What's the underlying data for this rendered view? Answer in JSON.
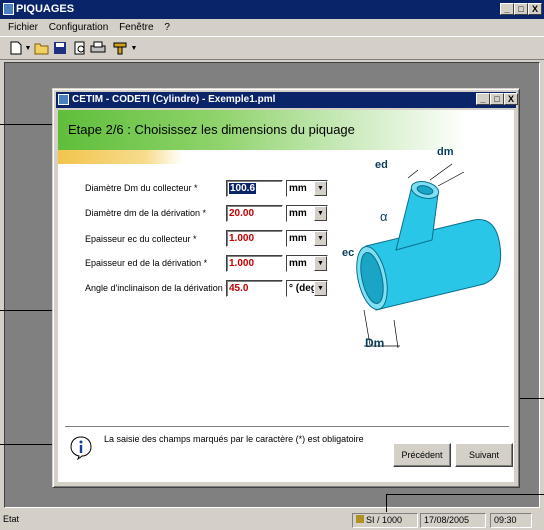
{
  "app": {
    "title": "PIQUAGES",
    "controls": {
      "minimize": "_",
      "maximize": "□",
      "close": "X"
    }
  },
  "menu": {
    "items": [
      {
        "label": "Fichier"
      },
      {
        "label": "Configuration"
      },
      {
        "label": "Fenêtre"
      },
      {
        "label": "?"
      }
    ]
  },
  "toolbar": {
    "buttons": [
      {
        "icon": "new-document-icon"
      },
      {
        "icon": "open-folder-icon"
      },
      {
        "icon": "save-icon"
      },
      {
        "icon": "print-preview-icon"
      },
      {
        "icon": "print-icon"
      },
      {
        "icon": "tools-icon"
      }
    ]
  },
  "child_window": {
    "title": "CETIM - CODETI (Cylindre) - Exemple1.pml",
    "controls": {
      "minimize": "_",
      "maximize": "□",
      "close": "X"
    }
  },
  "wizard": {
    "step_title": "Etape 2/6 : Choisissez les dimensions du piquage",
    "fields": [
      {
        "label": "Diamètre Dm du collecteur *",
        "value": "100.6",
        "unit": "mm",
        "selected": true
      },
      {
        "label": "Diamètre dm de la dérivation *",
        "value": "20.00",
        "unit": "mm"
      },
      {
        "label": "Epaisseur ec  du collecteur *",
        "value": "1.000",
        "unit": "mm"
      },
      {
        "label": "Epaisseur ed de la dérivation *",
        "value": "1.000",
        "unit": "mm"
      },
      {
        "label": "Angle d'inclinaison de la dérivation *",
        "value": "45.0",
        "unit": "° (deg)"
      }
    ],
    "diagram_labels": {
      "ed": "ed",
      "dm": "dm",
      "alpha": "α",
      "ec": "ec",
      "Dm": "Dm"
    },
    "info_text": "La saisie des champs marqués par le caractère (*) est obligatoire",
    "buttons": {
      "previous": "Précédent",
      "next": "Suivant"
    }
  },
  "statusbar": {
    "state": "Etat",
    "units": "SI / 1000",
    "date": "17/08/2005",
    "time": "09:30"
  },
  "colors": {
    "titlebar": "#0a246a",
    "banner_green": "#5fbe3a",
    "banner_orange": "#f2c44c",
    "pipe_cyan": "#29c6e8",
    "value_red": "#c00000"
  }
}
